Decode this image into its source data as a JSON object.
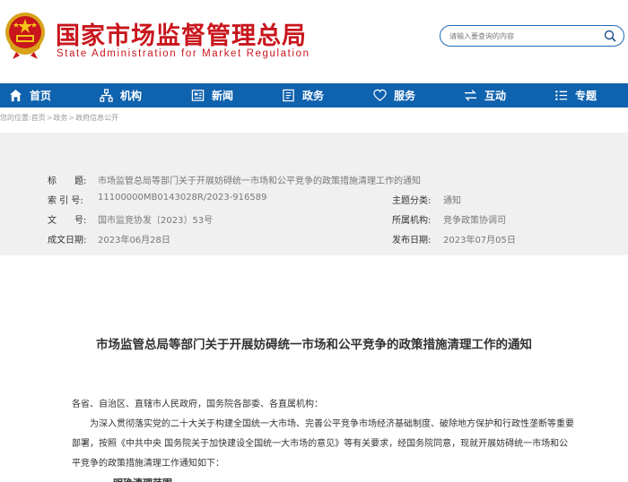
{
  "header": {
    "title_cn": "国家市场监督管理总局",
    "title_en": "State Administration for Market Regulation",
    "search_placeholder": "请输入要查询的内容"
  },
  "nav": {
    "items": [
      {
        "label": "首页",
        "icon": "home-icon"
      },
      {
        "label": "机构",
        "icon": "org-icon"
      },
      {
        "label": "新闻",
        "icon": "news-icon"
      },
      {
        "label": "政务",
        "icon": "gov-affairs-icon"
      },
      {
        "label": "服务",
        "icon": "service-icon"
      },
      {
        "label": "互动",
        "icon": "interact-icon"
      },
      {
        "label": "专题",
        "icon": "topic-icon"
      }
    ]
  },
  "breadcrumb": {
    "prefix": "您的位置:",
    "items": [
      "首页",
      "政务",
      "政府信息公开"
    ],
    "separator": ">"
  },
  "meta": {
    "title_label": "标　　题:",
    "title_value": "市场监管总局等部门关于开展妨碍统一市场和公平竞争的政策措施清理工作的通知",
    "index_label": "索 引 号:",
    "index_value": "11100000MB0143028R/2023-916589",
    "category_label": "主题分类:",
    "category_value": "通知",
    "docno_label": "文　　号:",
    "docno_value": "国市监竞协发〔2023〕53号",
    "dept_label": "所属机构:",
    "dept_value": "竞争政策协调司",
    "date_label": "成文日期:",
    "date_value": "2023年06月28日",
    "pub_label": "发布日期:",
    "pub_value": "2023年07月05日"
  },
  "article": {
    "title": "市场监管总局等部门关于开展妨碍统一市场和公平竞争的政策措施清理工作的通知",
    "greeting": "各省、自治区、直辖市人民政府，国务院各部委、各直属机构：",
    "body": "为深入贯彻落实党的二十大关于构建全国统一大市场、完善公平竞争市场经济基础制度、破除地方保护和行政性垄断等重要部署，按照《中共中央 国务院关于加快建设全国统一大市场的意见》等有关要求，经国务院同意，现就开展妨碍统一市场和公平竞争的政策措施清理工作通知如下：",
    "next_heading": "一、明确清理范围"
  },
  "colors": {
    "brand_red": "#c8161d",
    "nav_blue": "#0f62ae"
  }
}
